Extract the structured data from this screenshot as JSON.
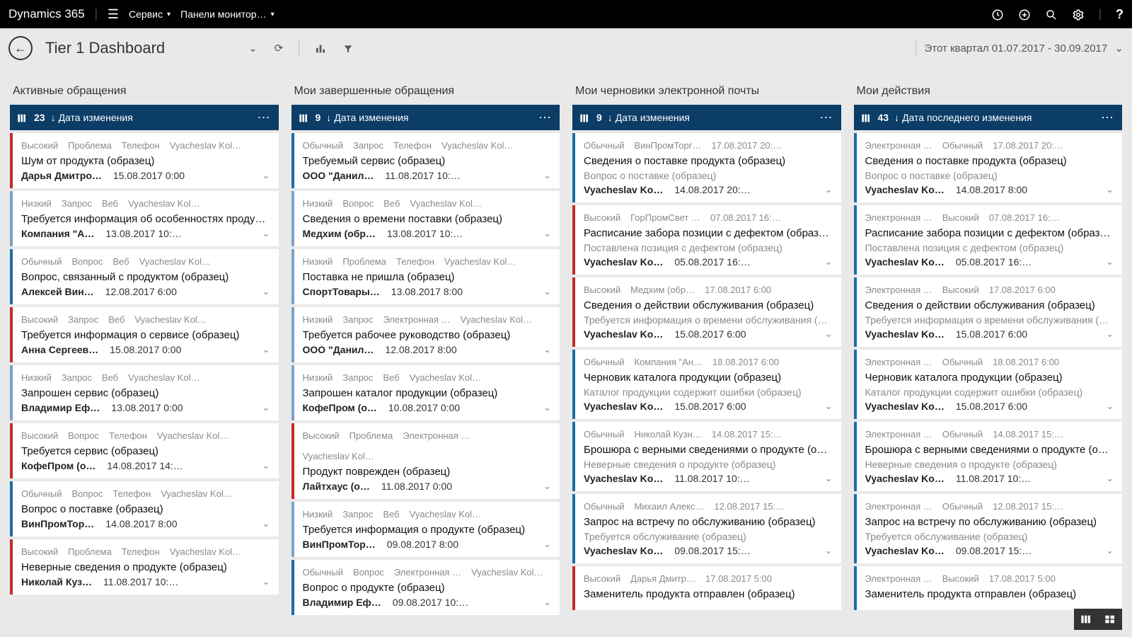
{
  "top": {
    "brand": "Dynamics 365",
    "area": "Сервис",
    "page": "Панели монитор…"
  },
  "sub": {
    "title": "Tier 1 Dashboard",
    "range": "Этот квартал 01.07.2017 - 30.09.2017"
  },
  "columns": [
    {
      "title": "Активные обращения",
      "count": "23",
      "sort": "Дата изменения",
      "cards": [
        {
          "sev": "high",
          "meta": [
            "Высокий",
            "Проблема",
            "Телефон",
            "Vyacheslav Kol…"
          ],
          "title": "Шум от продукта (образец)",
          "who": "Дарья Дмитро…",
          "when": "15.08.2017 0:00"
        },
        {
          "sev": "low",
          "meta": [
            "Низкий",
            "Запрос",
            "Веб",
            "Vyacheslav Kol…"
          ],
          "title": "Требуется информация об особенностях продукта (…",
          "who": "Компания \"А…",
          "when": "13.08.2017 10:…"
        },
        {
          "sev": "normal",
          "meta": [
            "Обычный",
            "Вопрос",
            "Веб",
            "Vyacheslav Kol…"
          ],
          "title": "Вопрос, связанный с продуктом (образец)",
          "who": "Алексей Вин…",
          "when": "12.08.2017 6:00"
        },
        {
          "sev": "high",
          "meta": [
            "Высокий",
            "Запрос",
            "Веб",
            "Vyacheslav Kol…"
          ],
          "title": "Требуется информация о сервисе (образец)",
          "who": "Анна Сергеев…",
          "when": "15.08.2017 0:00"
        },
        {
          "sev": "low",
          "meta": [
            "Низкий",
            "Запрос",
            "Веб",
            "Vyacheslav Kol…"
          ],
          "title": "Запрошен сервис (образец)",
          "who": "Владимир Еф…",
          "when": "13.08.2017 0:00"
        },
        {
          "sev": "high",
          "meta": [
            "Высокий",
            "Вопрос",
            "Телефон",
            "Vyacheslav Kol…"
          ],
          "title": "Требуется сервис (образец)",
          "who": "КофеПром (о…",
          "when": "14.08.2017 14:…"
        },
        {
          "sev": "normal",
          "meta": [
            "Обычный",
            "Вопрос",
            "Телефон",
            "Vyacheslav Kol…"
          ],
          "title": "Вопрос о поставке (образец)",
          "who": "ВинПромТор…",
          "when": "14.08.2017 8:00"
        },
        {
          "sev": "high",
          "meta": [
            "Высокий",
            "Проблема",
            "Телефон",
            "Vyacheslav Kol…"
          ],
          "title": "Неверные сведения о продукте (образец)",
          "who": "Николай Куз…",
          "when": "11.08.2017 10:…"
        }
      ]
    },
    {
      "title": "Мои завершенные обращения",
      "count": "9",
      "sort": "Дата изменения",
      "cards": [
        {
          "sev": "normal",
          "meta": [
            "Обычный",
            "Запрос",
            "Телефон",
            "Vyacheslav Kol…"
          ],
          "title": "Требуемый сервис (образец)",
          "who": "ООО \"Данил…",
          "when": "11.08.2017 10:…"
        },
        {
          "sev": "low",
          "meta": [
            "Низкий",
            "Вопрос",
            "Веб",
            "Vyacheslav Kol…"
          ],
          "title": "Сведения о времени поставки (образец)",
          "who": "Медхим (обр…",
          "when": "13.08.2017 10:…"
        },
        {
          "sev": "low",
          "meta": [
            "Низкий",
            "Проблема",
            "Телефон",
            "Vyacheslav Kol…"
          ],
          "title": "Поставка не пришла (образец)",
          "who": "СпортТовары…",
          "when": "13.08.2017 8:00"
        },
        {
          "sev": "low",
          "meta": [
            "Низкий",
            "Запрос",
            "Электронная …",
            "Vyacheslav Kol…"
          ],
          "title": "Требуется рабочее руководство (образец)",
          "who": "ООО \"Данил…",
          "when": "12.08.2017 8:00"
        },
        {
          "sev": "low",
          "meta": [
            "Низкий",
            "Запрос",
            "Веб",
            "Vyacheslav Kol…"
          ],
          "title": "Запрошен каталог продукции (образец)",
          "who": "КофеПром (о…",
          "when": "10.08.2017 0:00"
        },
        {
          "sev": "high",
          "meta": [
            "Высокий",
            "Проблема",
            "Электронная …",
            "Vyacheslav Kol…"
          ],
          "title": "Продукт поврежден (образец)",
          "who": "Лайтхаус (о…",
          "when": "11.08.2017 0:00"
        },
        {
          "sev": "low",
          "meta": [
            "Низкий",
            "Запрос",
            "Веб",
            "Vyacheslav Kol…"
          ],
          "title": "Требуется информация о продукте (образец)",
          "who": "ВинПромТор…",
          "when": "09.08.2017 8:00"
        },
        {
          "sev": "normal",
          "meta": [
            "Обычный",
            "Вопрос",
            "Электронная …",
            "Vyacheslav Kol…"
          ],
          "title": "Вопрос о продукте (образец)",
          "who": "Владимир Еф…",
          "when": "09.08.2017 10:…"
        }
      ]
    },
    {
      "title": "Мои черновики электронной почты",
      "count": "9",
      "sort": "Дата изменения",
      "cards": [
        {
          "sev": "normal",
          "meta": [
            "Обычный",
            "ВинПромТорг…",
            "17.08.2017 20:…"
          ],
          "title": "Сведения о поставке продукта (образец)",
          "sub": "Вопрос о поставке (образец)",
          "who": "Vyacheslav Ko…",
          "when": "14.08.2017 20:…"
        },
        {
          "sev": "high",
          "meta": [
            "Высокий",
            "ГорПромСвет …",
            "07.08.2017 16:…"
          ],
          "title": "Расписание забора позиции с дефектом (образец)",
          "sub": "Поставлена позиция с дефектом (образец)",
          "who": "Vyacheslav Ko…",
          "when": "05.08.2017 16:…"
        },
        {
          "sev": "high",
          "meta": [
            "Высокий",
            "Медхим (обр…",
            "17.08.2017 6:00"
          ],
          "title": "Сведения о действии обслуживания (образец)",
          "sub": "Требуется информация о времени обслуживания (о…",
          "who": "Vyacheslav Ko…",
          "when": "15.08.2017 6:00"
        },
        {
          "sev": "normal",
          "meta": [
            "Обычный",
            "Компания \"Ан…",
            "18.08.2017 6:00"
          ],
          "title": "Черновик каталога продукции (образец)",
          "sub": "Каталог продукции содержит ошибки (образец)",
          "who": "Vyacheslav Ko…",
          "when": "15.08.2017 6:00"
        },
        {
          "sev": "normal",
          "meta": [
            "Обычный",
            "Николай Кузн…",
            "14.08.2017 15:…"
          ],
          "title": "Брошюра с верными сведениями о продукте (образ…",
          "sub": "Неверные сведения о продукте (образец)",
          "who": "Vyacheslav Ko…",
          "when": "11.08.2017 10:…"
        },
        {
          "sev": "normal",
          "meta": [
            "Обычный",
            "Михаил Алекс…",
            "12.08.2017 15:…"
          ],
          "title": "Запрос на встречу по обслуживанию (образец)",
          "sub": "Требуется обслуживание (образец)",
          "who": "Vyacheslav Ko…",
          "when": "09.08.2017 15:…"
        },
        {
          "sev": "high",
          "meta": [
            "Высокий",
            "Дарья Дмитр…",
            "17.08.2017 5:00"
          ],
          "title": "Заменитель продукта отправлен (образец)",
          "sub": "",
          "who": "",
          "when": ""
        }
      ]
    },
    {
      "title": "Мои действия",
      "count": "43",
      "sort": "Дата последнего изменения",
      "cards": [
        {
          "sev": "email",
          "meta": [
            "Электронная …",
            "Обычный",
            "17.08.2017 20:…"
          ],
          "title": "Сведения о поставке продукта (образец)",
          "sub": "Вопрос о поставке (образец)",
          "who": "Vyacheslav Ko…",
          "when": "14.08.2017 8:00"
        },
        {
          "sev": "email",
          "meta": [
            "Электронная …",
            "Высокий",
            "07.08.2017 16:…"
          ],
          "title": "Расписание забора позиции с дефектом (образец)",
          "sub": "Поставлена позиция с дефектом (образец)",
          "who": "Vyacheslav Ko…",
          "when": "05.08.2017 16:…"
        },
        {
          "sev": "email",
          "meta": [
            "Электронная …",
            "Высокий",
            "17.08.2017 6:00"
          ],
          "title": "Сведения о действии обслуживания (образец)",
          "sub": "Требуется информация о времени обслуживания (о…",
          "who": "Vyacheslav Ko…",
          "when": "15.08.2017 6:00"
        },
        {
          "sev": "email",
          "meta": [
            "Электронная …",
            "Обычный",
            "18.08.2017 6:00"
          ],
          "title": "Черновик каталога продукции (образец)",
          "sub": "Каталог продукции содержит ошибки (образец)",
          "who": "Vyacheslav Ko…",
          "when": "15.08.2017 6:00"
        },
        {
          "sev": "email",
          "meta": [
            "Электронная …",
            "Обычный",
            "14.08.2017 15:…"
          ],
          "title": "Брошюра с верными сведениями о продукте (образ…",
          "sub": "Неверные сведения о продукте (образец)",
          "who": "Vyacheslav Ko…",
          "when": "11.08.2017 10:…"
        },
        {
          "sev": "email",
          "meta": [
            "Электронная …",
            "Обычный",
            "12.08.2017 15:…"
          ],
          "title": "Запрос на встречу по обслуживанию (образец)",
          "sub": "Требуется обслуживание (образец)",
          "who": "Vyacheslav Ko…",
          "when": "09.08.2017 15:…"
        },
        {
          "sev": "email",
          "meta": [
            "Электронная …",
            "Высокий",
            "17.08.2017 5:00"
          ],
          "title": "Заменитель продукта отправлен (образец)",
          "sub": "",
          "who": "",
          "when": ""
        }
      ]
    }
  ]
}
